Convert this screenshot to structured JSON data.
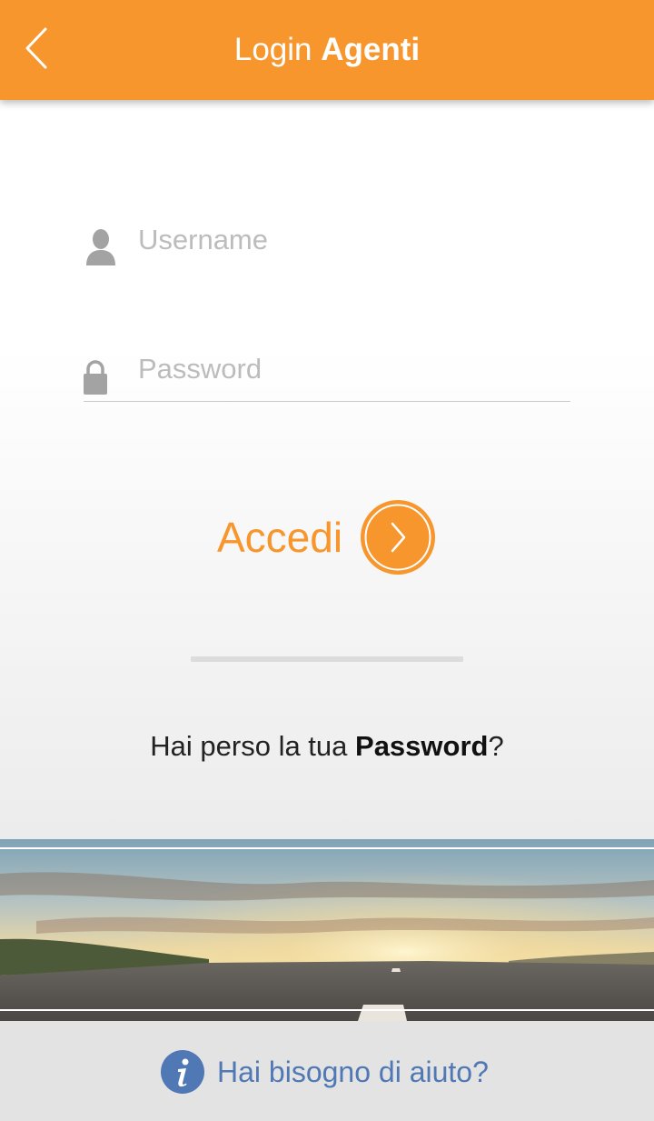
{
  "header": {
    "title_light": "Login",
    "title_bold": "Agenti",
    "back_icon": "chevron-left-icon",
    "background_color": "#f7962d"
  },
  "form": {
    "username": {
      "placeholder": "Username",
      "value": "",
      "icon": "user-icon"
    },
    "password": {
      "placeholder": "Password",
      "value": "",
      "icon": "lock-icon"
    },
    "login_button": {
      "label": "Accedi",
      "icon": "chevron-right-circle-icon"
    }
  },
  "forgot": {
    "prefix": "Hai perso la tua ",
    "link": "Password",
    "suffix": "?"
  },
  "banner": {
    "image": "road-sunset-image"
  },
  "help": {
    "label": "Hai bisogno di aiuto?",
    "icon": "info-icon",
    "color": "#4f78b5"
  },
  "colors": {
    "accent": "#f7962d",
    "placeholder": "#bcbcbc",
    "help_link": "#4f78b5"
  }
}
